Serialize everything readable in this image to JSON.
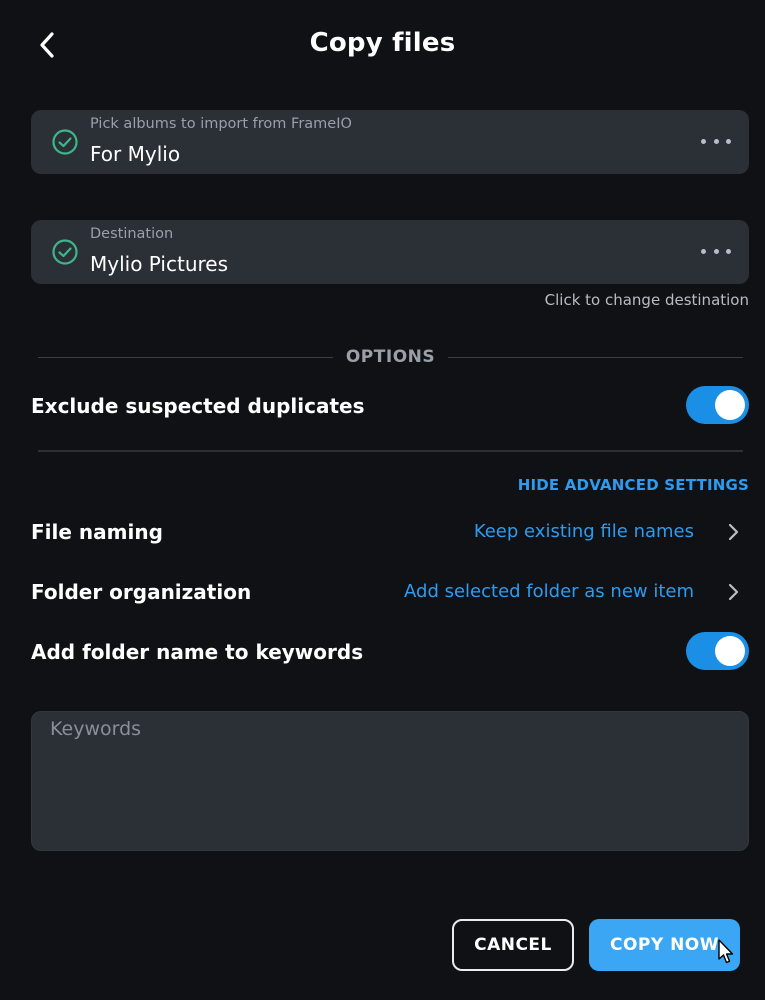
{
  "header": {
    "title": "Copy files",
    "back_icon": "chevron-left-icon"
  },
  "source_field": {
    "label": "Pick albums to import from FrameIO",
    "value": "For Mylio",
    "status_icon": "check-circle-icon",
    "menu_icon": "more-horizontal-icon"
  },
  "destination_field": {
    "label": "Destination",
    "value": "Mylio Pictures",
    "status_icon": "check-circle-icon",
    "menu_icon": "more-horizontal-icon",
    "hint": "Click to change destination"
  },
  "options": {
    "heading": "OPTIONS",
    "exclude_duplicates": {
      "label": "Exclude suspected duplicates",
      "enabled": true
    },
    "advanced_link": "HIDE ADVANCED SETTINGS",
    "file_naming": {
      "label": "File naming",
      "value": "Keep existing file names"
    },
    "folder_organization": {
      "label": "Folder organization",
      "value": "Add selected folder as new item"
    },
    "add_folder_keywords": {
      "label": "Add folder name to keywords",
      "enabled": true
    },
    "keywords": {
      "placeholder": "Keywords",
      "value": ""
    }
  },
  "footer": {
    "cancel_label": "CANCEL",
    "copy_label": "COPY NOW"
  },
  "colors": {
    "background": "#0f1114",
    "field_bg": "#2b2f36",
    "accent": "#2d9cf0",
    "toggle_on": "#1b8ee6",
    "primary_button": "#3aa6f4",
    "check_green": "#3fb58b"
  }
}
